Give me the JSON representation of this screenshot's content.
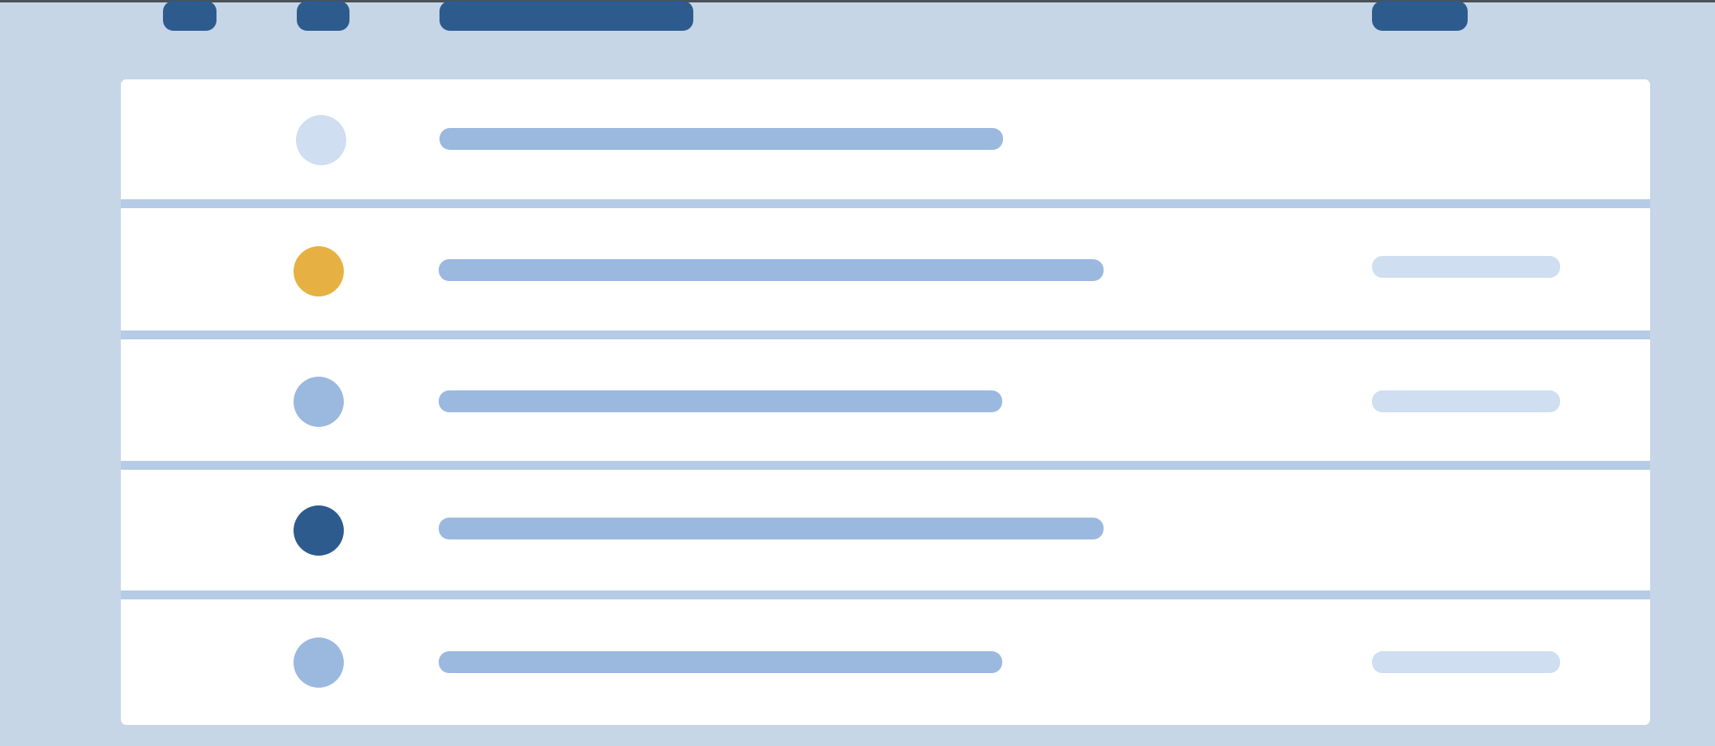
{
  "colors": {
    "page_background": "#c6d6e6",
    "top_edge": "#4b5158",
    "header_pill": "#2d5b8e",
    "panel_background": "#ffffff",
    "divider": "#b5cbe6",
    "title_bar": "#9bb9df",
    "meta_bar": "#cfdef0"
  },
  "header": {
    "columns": [
      {
        "name": "column-header-1",
        "label": ""
      },
      {
        "name": "column-header-2",
        "label": ""
      },
      {
        "name": "column-header-3",
        "label": ""
      },
      {
        "name": "column-header-4",
        "label": ""
      }
    ]
  },
  "list": {
    "rows": [
      {
        "status_icon": "status-dot-icon",
        "status_color": "#cfdef0",
        "title": "",
        "meta": null
      },
      {
        "status_icon": "status-dot-icon",
        "status_color": "#e6b142",
        "title": "",
        "meta": ""
      },
      {
        "status_icon": "status-dot-icon",
        "status_color": "#9bb9df",
        "title": "",
        "meta": ""
      },
      {
        "status_icon": "status-dot-icon",
        "status_color": "#2d5b8e",
        "title": "",
        "meta": null
      },
      {
        "status_icon": "status-dot-icon",
        "status_color": "#9bb9df",
        "title": "",
        "meta": ""
      }
    ]
  }
}
